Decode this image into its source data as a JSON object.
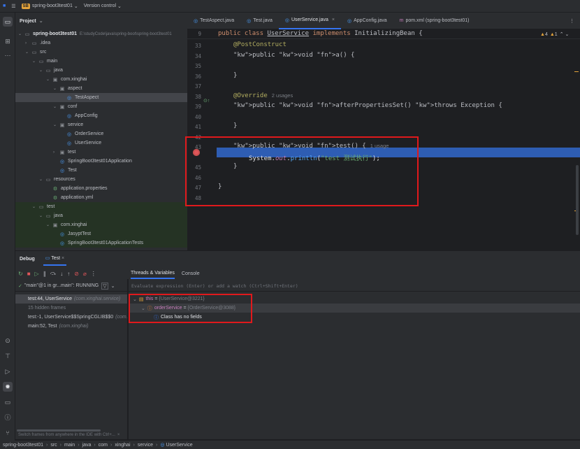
{
  "topbar": {
    "menu_icon": "hamburger-icon",
    "project_badge": "SB",
    "project_name": "spring-boot3test01",
    "vcs": "Version control"
  },
  "project_panel": {
    "title": "Project",
    "tree": [
      {
        "label": "spring-boot3test01",
        "extra": "E:\\studyCode\\java\\spring-boot\\spring-boot3test01",
        "kind": "root"
      },
      {
        "label": ".idea",
        "kind": "folder"
      },
      {
        "label": "src",
        "kind": "folder"
      },
      {
        "label": "main",
        "kind": "folder"
      },
      {
        "label": "java",
        "kind": "folder"
      },
      {
        "label": "com.xinghai",
        "kind": "package"
      },
      {
        "label": "aspect",
        "kind": "package"
      },
      {
        "label": "TestAspect",
        "kind": "class"
      },
      {
        "label": "conf",
        "kind": "package"
      },
      {
        "label": "AppConfig",
        "kind": "class"
      },
      {
        "label": "service",
        "kind": "package"
      },
      {
        "label": "OrderService",
        "kind": "class"
      },
      {
        "label": "UserService",
        "kind": "class"
      },
      {
        "label": "test",
        "kind": "package"
      },
      {
        "label": "SpringBoot3test01Application",
        "kind": "class"
      },
      {
        "label": "Test",
        "kind": "class"
      },
      {
        "label": "resources",
        "kind": "folder"
      },
      {
        "label": "application.properties",
        "kind": "prop"
      },
      {
        "label": "application.yml",
        "kind": "prop"
      },
      {
        "label": "test",
        "kind": "folder"
      },
      {
        "label": "java",
        "kind": "folder"
      },
      {
        "label": "com.xinghai",
        "kind": "package"
      },
      {
        "label": "JasyptTest",
        "kind": "class"
      },
      {
        "label": "SpringBoot3test01ApplicationTests",
        "kind": "class"
      }
    ]
  },
  "editor": {
    "tabs": [
      "TestAspect.java",
      "Test.java",
      "UserService.java",
      "AppConfig.java",
      "pom.xml (spring-boot3test01)"
    ],
    "active_tab": "UserService.java",
    "inspection": {
      "warnings": "4",
      "weak": "1"
    },
    "header_line": {
      "num": "9",
      "text": "public class UserService implements InitializingBean {"
    },
    "lines": [
      {
        "num": "33",
        "text": "@PostConstruct"
      },
      {
        "num": "34",
        "text": "public void a() {"
      },
      {
        "num": "35",
        "text": ""
      },
      {
        "num": "36",
        "text": "}"
      },
      {
        "num": "37",
        "text": ""
      },
      {
        "num": "38",
        "text": "@Override",
        "hint": "2 usages"
      },
      {
        "num": "39",
        "text": "public void afterPropertiesSet() throws Exception {"
      },
      {
        "num": "40",
        "text": ""
      },
      {
        "num": "41",
        "text": "}"
      },
      {
        "num": "42",
        "text": ""
      },
      {
        "num": "43",
        "text": "public void test() {",
        "hint": "1 usage"
      },
      {
        "num": "",
        "text": "System.out.println(\"test 测试执行\");"
      },
      {
        "num": "45",
        "text": "}"
      },
      {
        "num": "46",
        "text": ""
      },
      {
        "num": "47",
        "text": "}"
      },
      {
        "num": "48",
        "text": ""
      }
    ]
  },
  "debug": {
    "title": "Debug",
    "tab": "Test",
    "subtabs": [
      "Threads & Variables",
      "Console"
    ],
    "thread": "\"main\"@1 in gr...main\": RUNNING",
    "eval_placeholder": "Evaluate expression (Enter) or add a watch (Ctrl+Shift+Enter)",
    "frames": [
      {
        "name": "test:44, UserService",
        "loc": "(com.xinghai.service)"
      },
      {
        "name": "15 hidden frames",
        "loc": ""
      },
      {
        "name": "test:-1, UserService$$SpringCGLIB$$0",
        "loc": "(com.xi"
      },
      {
        "name": "main:52, Test",
        "loc": "(com.xinghai)"
      }
    ],
    "vars": [
      {
        "name": "this",
        "eq": " = ",
        "val": "{UserService@3221}"
      },
      {
        "name": "orderService",
        "eq": " = ",
        "val": "{OrderService@3088}"
      },
      {
        "name": "Class has no fields",
        "eq": "",
        "val": ""
      }
    ],
    "footer": "Switch frames from anywhere in the IDE with Ctrl+..."
  },
  "status": {
    "crumbs": [
      "spring-boot3test01",
      "src",
      "main",
      "java",
      "com",
      "xinghai",
      "service",
      "UserService"
    ]
  },
  "colors": {
    "accent": "#3574f0",
    "highlight": "#2e5db3",
    "breakpoint": "#e0565a",
    "annotation_box": "#e0191c"
  }
}
